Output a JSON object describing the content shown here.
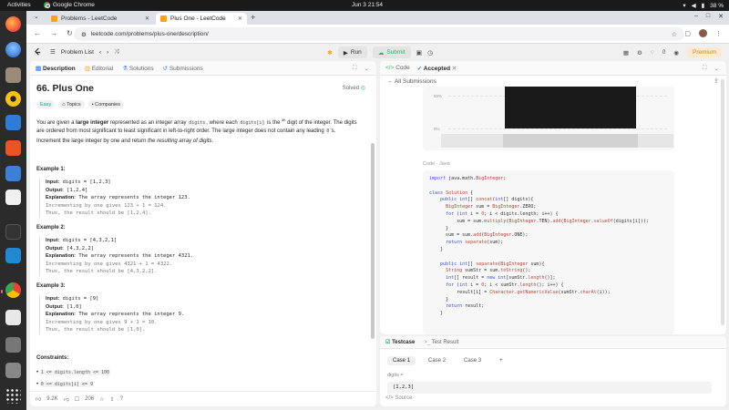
{
  "os": {
    "activities": "Activities",
    "app_name": "Google Chrome",
    "clock": "Jun 3  21:54",
    "battery": "38 %"
  },
  "browser": {
    "tabs": [
      {
        "label": "Problems - LeetCode"
      },
      {
        "label": "Plus One - LeetCode"
      }
    ],
    "url": "leetcode.com/problems/plus-one/description/"
  },
  "lc_nav": {
    "problem_list": "Problem List",
    "run": "Run",
    "submit": "Submit",
    "streak": "0",
    "premium": "Premium"
  },
  "left": {
    "tabs": [
      "Description",
      "Editorial",
      "Solutions",
      "Submissions"
    ],
    "title": "66. Plus One",
    "status": "Solved",
    "tags": [
      "Easy",
      "Topics",
      "Companies"
    ],
    "desc1_a": "You are given a ",
    "desc1_b": "large integer",
    "desc1_c": " represented as an integer array ",
    "desc1_code1": "digits",
    "desc1_d": ", where each ",
    "desc1_code2": "digits[i]",
    "desc1_e": " is the ",
    "desc1_sup": "ith",
    "desc1_f": " digit of the integer. The digits are ordered from most significant to least significant in left-to-right order. The large integer does not contain any leading ",
    "desc1_code3": "0",
    "desc1_g": "'s.",
    "desc2_a": "Increment the large integer by one and return ",
    "desc2_b": "the resulting array of digits",
    "desc2_c": ".",
    "examples": [
      {
        "heading": "Example 1:",
        "input": "digits = [1,2,3]",
        "output": "[1,2,4]",
        "explanation": "The array represents the integer 123.",
        "more": [
          "Incrementing by one gives 123 + 1 = 124.",
          "Thus, the result should be [1,2,4]."
        ]
      },
      {
        "heading": "Example 2:",
        "input": "digits = [4,3,2,1]",
        "output": "[4,3,2,2]",
        "explanation": "The array represents the integer 4321.",
        "more": [
          "Incrementing by one gives 4321 + 1 = 4322.",
          "Thus, the result should be [4,3,2,2]."
        ]
      },
      {
        "heading": "Example 3:",
        "input": "digits = [9]",
        "output": "[1,0]",
        "explanation": "The array represents the integer 9.",
        "more": [
          "Incrementing by one gives 9 + 1 = 10.",
          "Thus, the result should be [1,0]."
        ]
      }
    ],
    "label_input": "Input:",
    "label_output": "Output:",
    "label_explanation": "Explanation:",
    "constraints_heading": "Constraints:",
    "constraints": [
      "1 <= digits.length <= 100",
      "0 <= digits[i] <= 9"
    ],
    "likes": "9.2K",
    "comments": "206"
  },
  "right": {
    "tabs": [
      "Code",
      "Accepted"
    ],
    "all_submissions": "All Submissions",
    "pct_top": "50%",
    "pct_bottom": "0%",
    "code_label": "Code",
    "lang": "Java"
  },
  "testcase": {
    "tabs": [
      "Testcase",
      "Test Result"
    ],
    "cases": [
      "Case 1",
      "Case 2",
      "Case 3"
    ],
    "param": "digits =",
    "value": "[1,2,3]",
    "source": "Source"
  },
  "colors": {
    "easy": "#00af9b",
    "accepted": "#2db55d",
    "leetcode_orange": "#ffa116"
  }
}
